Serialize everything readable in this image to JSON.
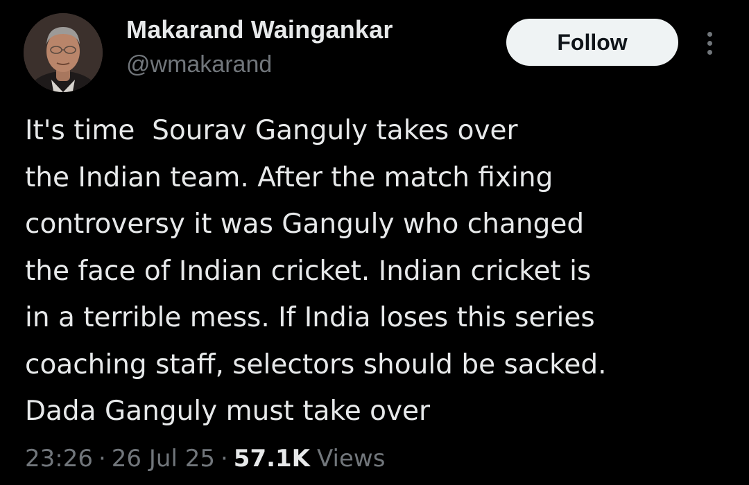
{
  "author": {
    "display_name": "Makarand Waingankar",
    "handle": "@wmakarand",
    "avatar_icon": "profile-photo"
  },
  "actions": {
    "follow_label": "Follow",
    "more_icon": "more-vertical-icon"
  },
  "tweet": {
    "lines": [
      "It's time  Sourav Ganguly takes over",
      "the Indian team. After the match fixing",
      "controversy it was Ganguly who changed",
      "the face of Indian cricket. Indian cricket is",
      "in a terrible mess. If India loses this series",
      "coaching staff, selectors should be sacked.",
      "Dada Ganguly must take over"
    ]
  },
  "meta": {
    "time": "23:26",
    "separator": "·",
    "date": "26 Jul 25",
    "views_count": "57.1K",
    "views_label": "Views"
  },
  "colors": {
    "background": "#000000",
    "primary_text": "#e7e9ea",
    "secondary_text": "#71767b",
    "follow_button_bg": "#eff3f4",
    "follow_button_text": "#0f1419"
  }
}
